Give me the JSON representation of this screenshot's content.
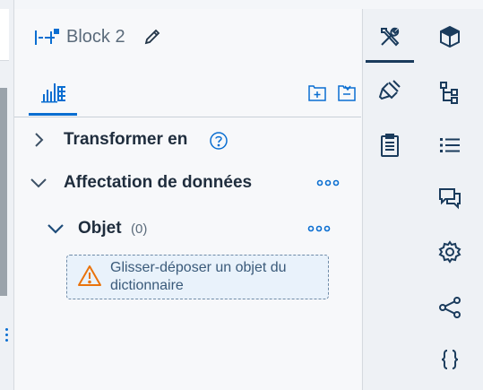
{
  "block": {
    "title": "Block 2"
  },
  "sections": {
    "transform": {
      "label": "Transformer en"
    },
    "data_assignment": {
      "label": "Affectation de données"
    },
    "object": {
      "label": "Objet",
      "count": "(0)"
    }
  },
  "dropzone": {
    "text": "Glisser-déposer un objet du dictionnaire"
  },
  "colors": {
    "accent": "#0a6ed1",
    "tool_active": "#1a3b5c",
    "warning": "#e9730c",
    "text_main": "#1f2d3d"
  },
  "icons": {
    "tabs": [
      "chart-table-icon"
    ],
    "tools": [
      "build-icon",
      "format-brush-icon",
      "clipboard-icon"
    ],
    "right": [
      "cube-icon",
      "hierarchy-icon",
      "list-icon",
      "comments-icon",
      "settings-icon",
      "share-icon",
      "curly-braces-icon"
    ]
  }
}
